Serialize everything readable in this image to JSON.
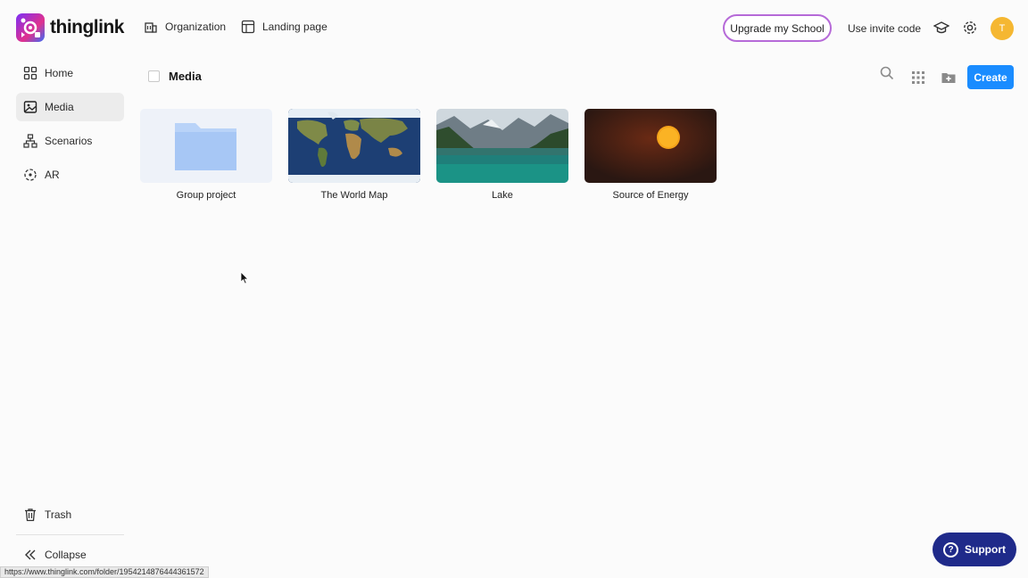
{
  "brand": {
    "name": "thinglink"
  },
  "topnav": [
    {
      "label": "Organization",
      "icon": "building-icon"
    },
    {
      "label": "Landing page",
      "icon": "layout-icon"
    }
  ],
  "header": {
    "upgrade_label": "Upgrade my School",
    "invite_label": "Use invite code",
    "avatar_initial": "T",
    "avatar_color": "#f5b731"
  },
  "sidebar": {
    "items": [
      {
        "label": "Home",
        "icon": "grid-icon",
        "active": false
      },
      {
        "label": "Media",
        "icon": "image-icon",
        "active": true
      },
      {
        "label": "Scenarios",
        "icon": "hierarchy-icon",
        "active": false
      },
      {
        "label": "AR",
        "icon": "ar-icon",
        "active": false
      }
    ],
    "trash_label": "Trash",
    "collapse_label": "Collapse"
  },
  "content": {
    "title": "Media",
    "create_label": "Create",
    "items": [
      {
        "label": "Group project",
        "type": "folder"
      },
      {
        "label": "The World Map",
        "type": "image"
      },
      {
        "label": "Lake",
        "type": "image"
      },
      {
        "label": "Source of Energy",
        "type": "image"
      }
    ]
  },
  "support": {
    "label": "Support"
  },
  "statusbar": {
    "url": "https://www.thinglink.com/folder/1954214876444361572"
  },
  "colors": {
    "accent": "#1a8cff",
    "support": "#1f2a8a"
  }
}
